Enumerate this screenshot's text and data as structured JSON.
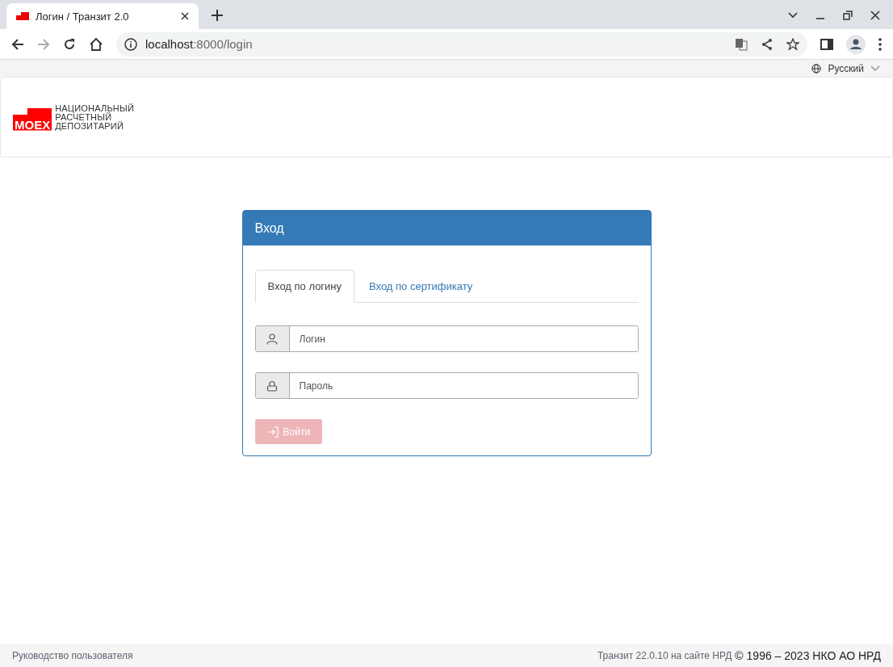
{
  "browser": {
    "tab_title": "Логин / Транзит 2.0",
    "url_host": "localhost",
    "url_path": ":8000/login"
  },
  "language": {
    "label": "Русский"
  },
  "logo": {
    "mark": "MOEX",
    "lines": [
      "НАЦИОНАЛЬНЫЙ",
      "РАСЧЕТНЫЙ",
      "ДЕПОЗИТАРИЙ"
    ]
  },
  "login_card": {
    "title": "Вход",
    "tabs": [
      {
        "label": "Вход по логину",
        "selected": true
      },
      {
        "label": "Вход по сертификату",
        "selected": false
      }
    ],
    "fields": [
      {
        "kind": "user",
        "placeholder": "Логин"
      },
      {
        "kind": "lock",
        "placeholder": "Пароль"
      }
    ],
    "submit": {
      "label": "Войти",
      "disabled": true
    }
  },
  "footer": {
    "manual_link": "Руководство пользователя",
    "version_link": "Транзит 22.0.10 на сайте НРД",
    "copyright": "© 1996 – 2023 НКО АО НРД"
  }
}
